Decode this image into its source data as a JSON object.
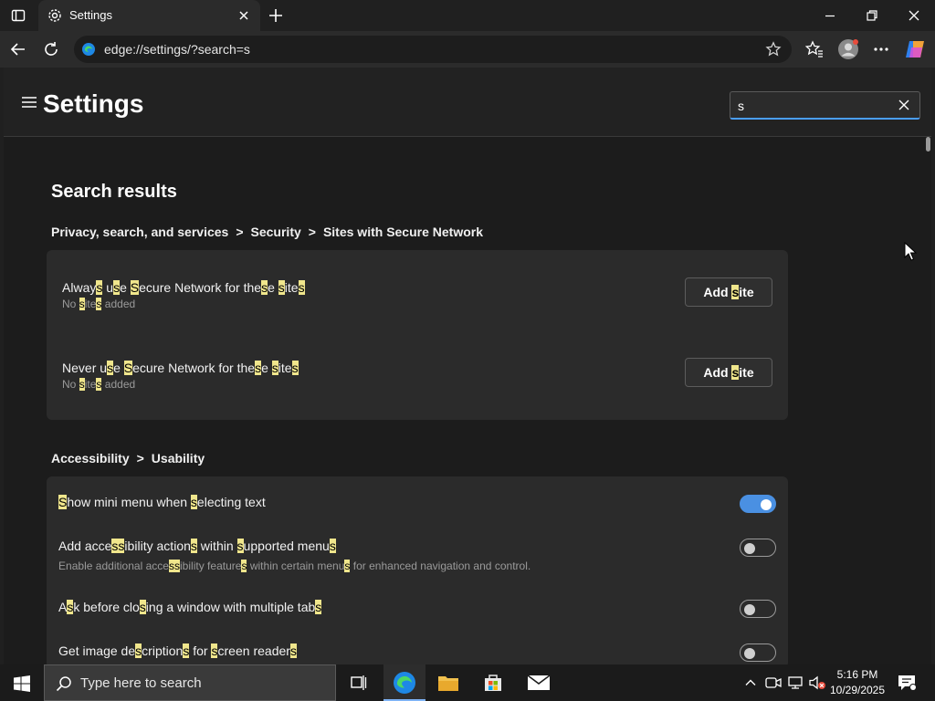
{
  "browser": {
    "tab_title": "Settings",
    "url": "edge://settings/?search=s"
  },
  "settings": {
    "title": "Settings",
    "search_value": "s"
  },
  "results": {
    "heading": "Search results",
    "section1": {
      "breadcrumb": [
        "Privacy, search, and services",
        "Security",
        "Sites with Secure Network"
      ],
      "separator": ">",
      "rows": [
        {
          "title": "Always use Secure Network for these sites",
          "subtitle": "No sites added",
          "button": "Add site"
        },
        {
          "title": "Never use Secure Network for these sites",
          "subtitle": "No sites added",
          "button": "Add site"
        }
      ]
    },
    "section2": {
      "breadcrumb": [
        "Accessibility",
        "Usability"
      ],
      "separator": ">",
      "rows": [
        {
          "title": "Show mini menu when selecting text",
          "subtitle": "",
          "state": "on"
        },
        {
          "title": "Add accessibility actions within supported menus",
          "subtitle": "Enable additional accessibility features within certain menus for enhanced navigation and control.",
          "state": "off"
        },
        {
          "title": "Ask before closing a window with multiple tabs",
          "subtitle": "",
          "state": "off"
        },
        {
          "title": "Get image descriptions for screen readers",
          "subtitle": "",
          "state": "off"
        }
      ]
    }
  },
  "taskbar": {
    "search_placeholder": "Type here to search",
    "time": "5:16 PM",
    "date": "10/29/2025"
  },
  "colors": {
    "highlight": "#f0e68c",
    "accent": "#4a90e2",
    "toggle_on": "#4a90e2"
  }
}
